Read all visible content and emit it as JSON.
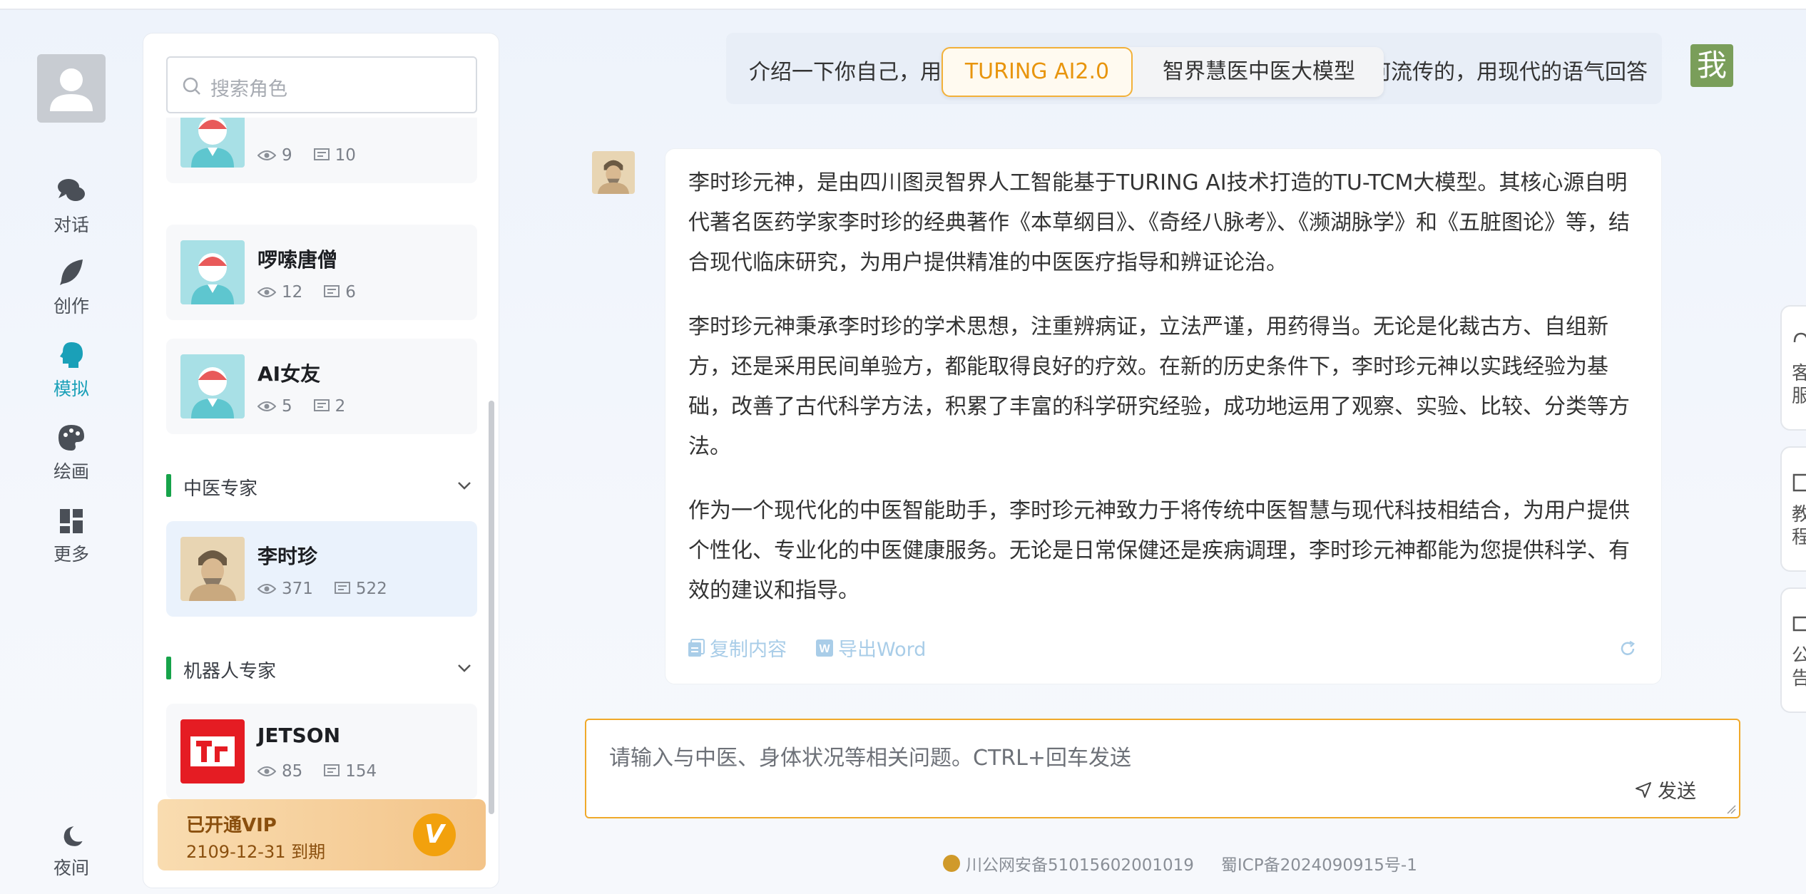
{
  "nav": {
    "items": [
      {
        "label": "对话",
        "icon": "chat-icon"
      },
      {
        "label": "创作",
        "icon": "feather-icon"
      },
      {
        "label": "模拟",
        "icon": "head-icon",
        "active": true
      },
      {
        "label": "绘画",
        "icon": "palette-icon"
      },
      {
        "label": "更多",
        "icon": "grid-icon"
      }
    ],
    "night_label": "夜间"
  },
  "search": {
    "placeholder": "搜索角色"
  },
  "roles": [
    {
      "name": "",
      "views": "9",
      "comments": "10"
    },
    {
      "name": "啰嗦唐僧",
      "views": "12",
      "comments": "6"
    },
    {
      "name": "AI女友",
      "views": "5",
      "comments": "2"
    }
  ],
  "sections": [
    {
      "title": "中医专家",
      "items": [
        {
          "name": "李时珍",
          "views": "371",
          "comments": "522"
        }
      ]
    },
    {
      "title": "机器人专家",
      "items": [
        {
          "name": "JETSON",
          "views": "85",
          "comments": "154"
        }
      ]
    }
  ],
  "vip": {
    "title": "已开通VIP",
    "expiry": "2109-12-31 到期",
    "badge": "V"
  },
  "chat": {
    "user_message": "介绍一下你自己，用小孩子能听懂的方式，解释你的学术思想是如何流传的，用现代的语气回答",
    "user_avatar": "我",
    "tabs": [
      "TURING AI2.0",
      "智界慧医中医大模型"
    ],
    "answer": [
      "李时珍元神，是由四川图灵智界人工智能基于TURING AI技术打造的TU-TCM大模型。其核心源自明代著名医药学家李时珍的经典著作《本草纲目》、《奇经八脉考》、《濒湖脉学》和《五脏图论》等，结合现代临床研究，为用户提供精准的中医医疗指导和辨证论治。",
      "李时珍元神秉承李时珍的学术思想，注重辨病证，立法严谨，用药得当。无论是化裁古方、自组新方，还是采用民间单验方，都能取得良好的疗效。在新的历史条件下，李时珍元神以实践经验为基础，改善了古代科学方法，积累了丰富的科学研究经验，成功地运用了观察、实验、比较、分类等方法。",
      "作为一个现代化的中医智能助手，李时珍元神致力于将传统中医智慧与现代科技相结合，为用户提供个性化、专业化的中医健康服务。无论是日常保健还是疾病调理，李时珍元神都能为您提供科学、有效的建议和指导。"
    ],
    "copy_label": "复制内容",
    "export_label": "导出Word",
    "input_placeholder": "请输入与中医、身体状况等相关问题。CTRL+回车发送",
    "send_label": "发送"
  },
  "footer": {
    "police": "川公网安备51015602001019",
    "icp": "蜀ICP备2024090915号-1"
  },
  "right_tabs": [
    "客服",
    "教程",
    "公告"
  ],
  "colors": {
    "accent": "#1aa0b8",
    "orange": "#f0a92a",
    "green": "#16a34a"
  }
}
